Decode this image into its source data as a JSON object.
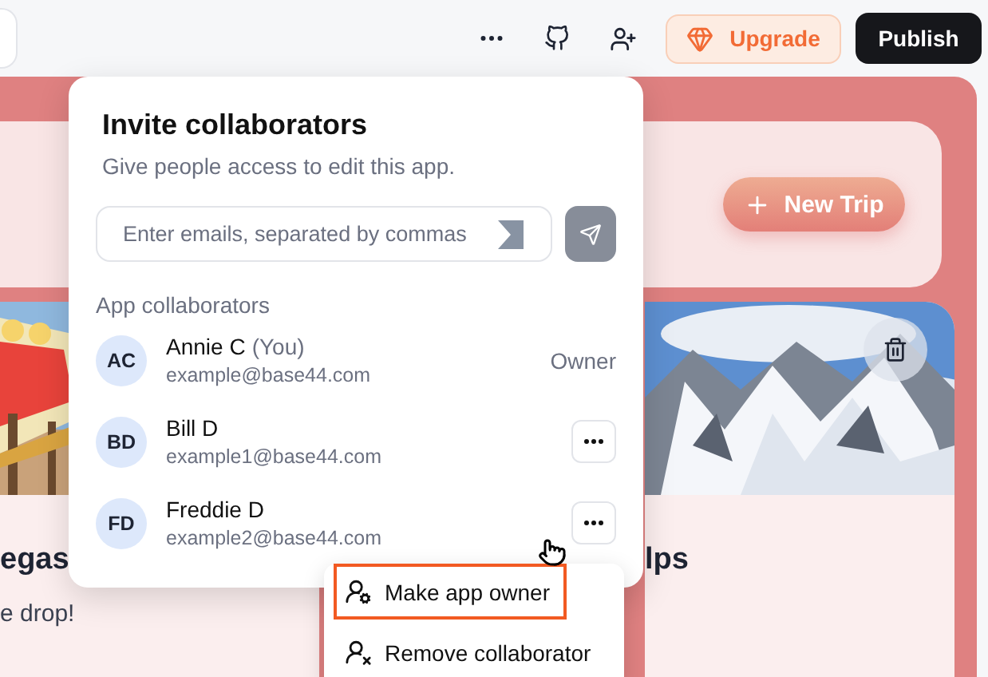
{
  "toolbar": {
    "upgrade": "Upgrade",
    "publish": "Publish"
  },
  "header": {
    "new_trip": "New Trip"
  },
  "trips": [
    {
      "title": "egas",
      "subtitle": "e drop!"
    },
    {
      "title": "lps"
    }
  ],
  "invite": {
    "title": "Invite collaborators",
    "subtitle": "Give people access to edit this app.",
    "email_field": {
      "placeholder": "Enter emails, separated by commas"
    },
    "section": "App collaborators",
    "collaborators": [
      {
        "kind": "owner",
        "initials": "AC",
        "name": "Annie C",
        "note": "(You)",
        "email": "example@base44.com",
        "role": "Owner"
      },
      {
        "kind": "member",
        "initials": "BD",
        "name": "Bill D",
        "email": "example1@base44.com"
      },
      {
        "kind": "member",
        "initials": "FD",
        "name": "Freddie D",
        "email": "example2@base44.com"
      }
    ]
  },
  "menu": {
    "items": [
      {
        "kind": "make-owner",
        "label": "Make app owner",
        "selected": true
      },
      {
        "kind": "remove",
        "label": "Remove collaborator",
        "selected": false
      }
    ]
  }
}
